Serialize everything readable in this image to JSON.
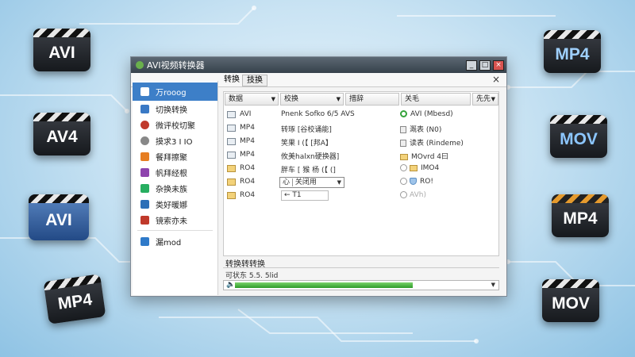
{
  "background": {
    "badges": [
      {
        "label": "AVI",
        "style": "dark"
      },
      {
        "label": "AV4",
        "style": "dark"
      },
      {
        "label": "AVI",
        "style": "blue"
      },
      {
        "label": "MP4",
        "style": "dark"
      },
      {
        "label": "MP4",
        "style": "dark-blue-text"
      },
      {
        "label": "MOV",
        "style": "dark-blue-text"
      },
      {
        "label": "MP4",
        "style": "orange-stripe"
      },
      {
        "label": "MOV",
        "style": "dark"
      }
    ]
  },
  "window": {
    "title": "AVI视频转换器",
    "minimize": "_",
    "maximize": "□",
    "close": "×"
  },
  "tabs": [
    {
      "label": "转换"
    },
    {
      "label": "技换"
    }
  ],
  "tabs_close": "×",
  "sidebar": {
    "items": [
      {
        "label": "万rooog",
        "icon": "converter-icon",
        "color": "#3a7fd0",
        "active": true
      },
      {
        "label": "切换转换",
        "icon": "list-icon",
        "color": "#3a79c5"
      },
      {
        "label": "微评校切聚",
        "icon": "palette-icon",
        "color": "#c0392b"
      },
      {
        "label": "摸求3 I IO",
        "icon": "settings-icon",
        "color": "#888888"
      },
      {
        "label": "餐拜擦聚",
        "icon": "gift-icon",
        "color": "#e67e22"
      },
      {
        "label": "帆拜经根",
        "icon": "grid-icon",
        "color": "#8e44ad"
      },
      {
        "label": "杂换未族",
        "icon": "film-icon",
        "color": "#27ae60"
      },
      {
        "label": "类好暖娜",
        "icon": "window-icon",
        "color": "#2c6fb7"
      },
      {
        "label": "镜索亦未",
        "icon": "image-icon",
        "color": "#c0392b"
      },
      {
        "label": "漏mod",
        "icon": "tools-icon",
        "color": "#2f7ac9",
        "after_separator": true
      }
    ]
  },
  "table": {
    "columns": [
      "数据",
      "校换",
      "措辞",
      "关毛",
      "先先"
    ],
    "rows": [
      {
        "c1": "AVI",
        "c2": "Pnenk Sofko 6/5 AVS",
        "c3": "",
        "c4": "AVI (Mbesd)",
        "c4_icon": "check-icon",
        "icon": "file"
      },
      {
        "c1": "MP4",
        "c2": "转琢 [谷校诵能]",
        "c3": "",
        "c4": "溉表 (N0)",
        "c4_icon": "doc-icon",
        "icon": "file"
      },
      {
        "c1": "MP4",
        "c2": "笑果 I (【   [邦A】",
        "c3": "",
        "c4": "读表 (Rindeme)",
        "c4_icon": "doc-icon",
        "icon": "file"
      },
      {
        "c1": "MP4",
        "c2": "攸美halxn硬换器]",
        "c3": "",
        "c4": "MOvrd 4曰",
        "c4_icon": "folder-icon",
        "icon": "file"
      },
      {
        "c1": "RO4",
        "c2": "胖车 [ 猴 杨 (【 (]",
        "c3": "",
        "c4": "IMO4",
        "c4_icon": "folder-icon",
        "icon": "folder"
      },
      {
        "c1": "RO4",
        "c2": "",
        "c3": "",
        "c4": "RO!",
        "c4_icon": "shield-icon",
        "icon": "folder",
        "combo_prefix": "心",
        "combo_value": "关闭用"
      },
      {
        "c1": "RO4",
        "c2": "← T1",
        "c3": "",
        "c4": "AVh)",
        "c4_icon": "dim-icon",
        "icon": "folder",
        "dim": true
      }
    ]
  },
  "progress": {
    "label": "转换转转换",
    "status": "可状东 5.5. 5lid",
    "percent": 0.71,
    "speaker": "🔈"
  }
}
